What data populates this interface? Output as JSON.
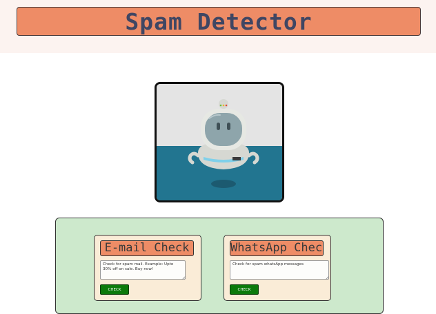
{
  "header": {
    "title": "Spam Detector"
  },
  "hero": {
    "image_icon": "robot-astronaut-icon"
  },
  "cards": [
    {
      "title": "E-mail Check",
      "placeholder": "Check for spam mail. Example: Upto 30% off on sale. Buy now!",
      "button_label": "CHECK"
    },
    {
      "title": "WhatsApp Check",
      "placeholder": "Check for spam whatsApp messages",
      "button_label": "CHECK"
    }
  ],
  "colors": {
    "header_band": "#fcf3f0",
    "title_bar": "#ee8c66",
    "title_text": "#3f4663",
    "panel": "#cde9cc",
    "card": "#faecd7",
    "button": "#0b7a0b"
  }
}
